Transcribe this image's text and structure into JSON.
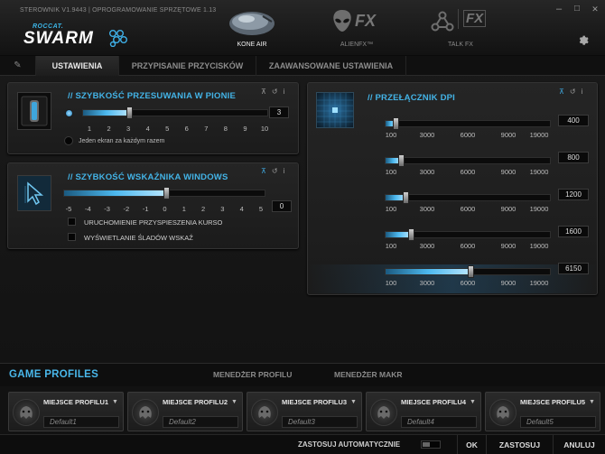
{
  "window": {
    "version_text": "STEROWNIK V1.9443 | OPROGRAMOWANIE SPRZĘTOWE 1.13",
    "minimize": "–",
    "maximize": "□",
    "close": "✕"
  },
  "logo": {
    "brand": "ROCCAT.",
    "product": "SWARM"
  },
  "header_tabs": [
    {
      "label": "KONE AIR",
      "icon": "mouse-icon",
      "active": true
    },
    {
      "label": "ALIENFX™",
      "icon": "alien-fx-icon",
      "active": false
    },
    {
      "label": "TALK FX",
      "icon": "talk-fx-icon",
      "active": false
    }
  ],
  "fx_text": "FX",
  "settings_icon": "gear-icon",
  "tabs": [
    {
      "label": "USTAWIENIA",
      "active": true
    },
    {
      "label": "PRZYPISANIE PRZYCISKÓW",
      "active": false
    },
    {
      "label": "ZAAWANSOWANE USTAWIENIA",
      "active": false
    }
  ],
  "vertical_scroll": {
    "title": "// SZYBKOŚĆ PRZESUWANIA W PIONIE",
    "ticks": [
      "1",
      "2",
      "3",
      "4",
      "5",
      "6",
      "7",
      "8",
      "9",
      "10"
    ],
    "value": "3",
    "value_num": 3,
    "option_label": "Jeden ekran za każdym razem"
  },
  "windows_pointer": {
    "title": "// SZYBKOŚĆ WSKAŹNIKA WINDOWS",
    "ticks": [
      "-5",
      "-4",
      "-3",
      "-2",
      "-1",
      "0",
      "1",
      "2",
      "3",
      "4",
      "5"
    ],
    "value": "0",
    "value_num": 0,
    "option1": "URUCHOMIENIE PRZYSPIESZENIA KURSO",
    "option2": "WYŚWIETLANIE ŚLADÓW WSKAŹ"
  },
  "dpi_switch": {
    "title": "// PRZEŁĄCZNIK DPI",
    "ticks": [
      "100",
      "3000",
      "6000",
      "9000",
      "19000"
    ],
    "levels": [
      {
        "value": "400",
        "num": 400,
        "active": false
      },
      {
        "value": "800",
        "num": 800,
        "active": false
      },
      {
        "value": "1200",
        "num": 1200,
        "active": false
      },
      {
        "value": "1600",
        "num": 1600,
        "active": false
      },
      {
        "value": "6150",
        "num": 6150,
        "active": true
      }
    ]
  },
  "panel_tools": {
    "pin": "📌",
    "reset": "↺",
    "info": "i"
  },
  "profiles": {
    "title": "GAME PROFILES",
    "tabs": [
      "MENEDŻER PROFILU",
      "MENEDŻER MAKR"
    ],
    "items": [
      {
        "name": "MIEJSCE PROFILU1",
        "value": "Default1"
      },
      {
        "name": "MIEJSCE PROFILU2",
        "value": "Default2"
      },
      {
        "name": "MIEJSCE PROFILU3",
        "value": "Default3"
      },
      {
        "name": "MIEJSCE PROFILU4",
        "value": "Default4"
      },
      {
        "name": "MIEJSCE PROFILU5",
        "value": "Default5"
      }
    ]
  },
  "footer": {
    "auto_apply": "ZASTOSUJ AUTOMATYCZNIE",
    "ok": "OK",
    "apply": "ZASTOSUJ",
    "cancel": "ANULUJ"
  },
  "colors": {
    "accent": "#43b3e6",
    "background": "#141414"
  }
}
